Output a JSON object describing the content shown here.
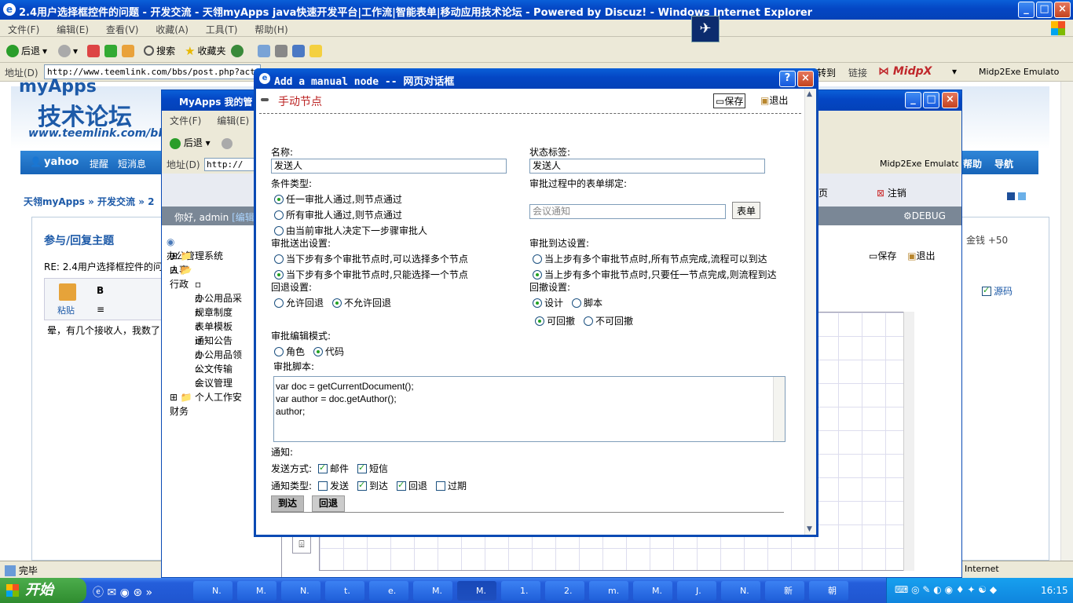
{
  "ie": {
    "title": "2.4用户选择框控件的问题 - 开发交流 - 天翎myApps java快速开发平台|工作流|智能表单|移动应用技术论坛 - Powered by Discuz! - Windows Internet Explorer",
    "menu": [
      "文件(F)",
      "编辑(E)",
      "查看(V)",
      "收藏(A)",
      "工具(T)",
      "帮助(H)"
    ],
    "back": "后退",
    "search": "搜索",
    "favorites": "收藏夹",
    "address_label": "地址(D)",
    "address": "http://www.teemlink.com/bbs/post.php?action=reply",
    "goto": "转到",
    "links": "链接",
    "midp": "Midp2Exe Emulato",
    "status": "完毕",
    "zone": "Internet"
  },
  "forum": {
    "logo_top": "myApps",
    "logo": "技术论坛",
    "url": "www.teemlink.com/bbs",
    "nav": [
      "yahoo",
      "提醒",
      "短消息"
    ],
    "nav_right": [
      "帮助",
      "导航"
    ],
    "breadcrumb": [
      "天翎myApps",
      "开发交流",
      "2"
    ],
    "reply_title": "参与/回复主题",
    "re_line": "RE: 2.4用户选择框控件的问",
    "paste": "粘贴",
    "editor_text": "晕，有几个接收人，我数了",
    "money": "金钱 +50",
    "source": "源码"
  },
  "app": {
    "title": "MyApps 我的管",
    "menu": [
      "文件(F)",
      "编辑(E)"
    ],
    "back": "后退",
    "address_label": "地址(D)",
    "address": "http://",
    "midp": "Midp2Exe Emulato",
    "home_tab": "页",
    "logout": "注销",
    "greeting": "你好, admin",
    "edit_link": "[编辑]",
    "debug": "DEBUG",
    "save": "保存",
    "exit": "退出",
    "tree": [
      "办公管理系统",
      "人事",
      "行政",
      "办公用品采",
      "规章制度",
      "表单模板",
      "通知公告",
      "办公用品领",
      "公文传输",
      "会议管理",
      "个人工作安",
      "财务"
    ]
  },
  "dialog": {
    "title": "Add a manual node -- 网页对话框",
    "heading": "手动节点",
    "save": "保存",
    "exit": "退出",
    "name_label": "名称:",
    "name_value": "发送人",
    "status_label": "状态标签:",
    "status_value": "发送人",
    "cond_label": "条件类型:",
    "cond_opts": [
      "任一审批人通过,则节点通过",
      "所有审批人通过,则节点通过",
      "由当前审批人决定下一步骤审批人"
    ],
    "form_label": "审批过程中的表单绑定:",
    "form_placeholder": "会议通知",
    "form_button": "表单",
    "out_label": "审批送出设置:",
    "out_opts": [
      "当下步有多个审批节点时,可以选择多个节点",
      "当下步有多个审批节点时,只能选择一个节点"
    ],
    "arrive_label": "审批到达设置:",
    "arrive_opts": [
      "当上步有多个审批节点时,所有节点完成,流程可以到达",
      "当上步有多个审批节点时,只要任一节点完成,则流程到达"
    ],
    "back_label": "回退设置:",
    "back_opts": [
      "允许回退",
      "不允许回退"
    ],
    "revoke_label": "回撤设置:",
    "revoke_mode": [
      "设计",
      "脚本"
    ],
    "revoke_opts": [
      "可回撤",
      "不可回撤"
    ],
    "edit_mode_label": "审批编辑模式:",
    "edit_mode": [
      "角色",
      "代码"
    ],
    "script_label": "审批脚本:",
    "script": [
      "var doc = getCurrentDocument();",
      "var author = doc.getAuthor();",
      "author;"
    ],
    "notify_label": "通知:",
    "send_label": "发送方式:",
    "send_opts": [
      "邮件",
      "短信"
    ],
    "type_label": "通知类型:",
    "type_opts": [
      "发送",
      "到达",
      "回退",
      "过期"
    ],
    "tabs": [
      "到达",
      "回退"
    ]
  },
  "taskbar": {
    "start": "开始",
    "items": [
      "N.",
      "M.",
      "N.",
      "t.",
      "e.",
      "M.",
      "M.",
      "1.",
      "2.",
      "m.",
      "M.",
      "J.",
      "N.",
      "新",
      "朝"
    ],
    "clock": "16:15"
  }
}
